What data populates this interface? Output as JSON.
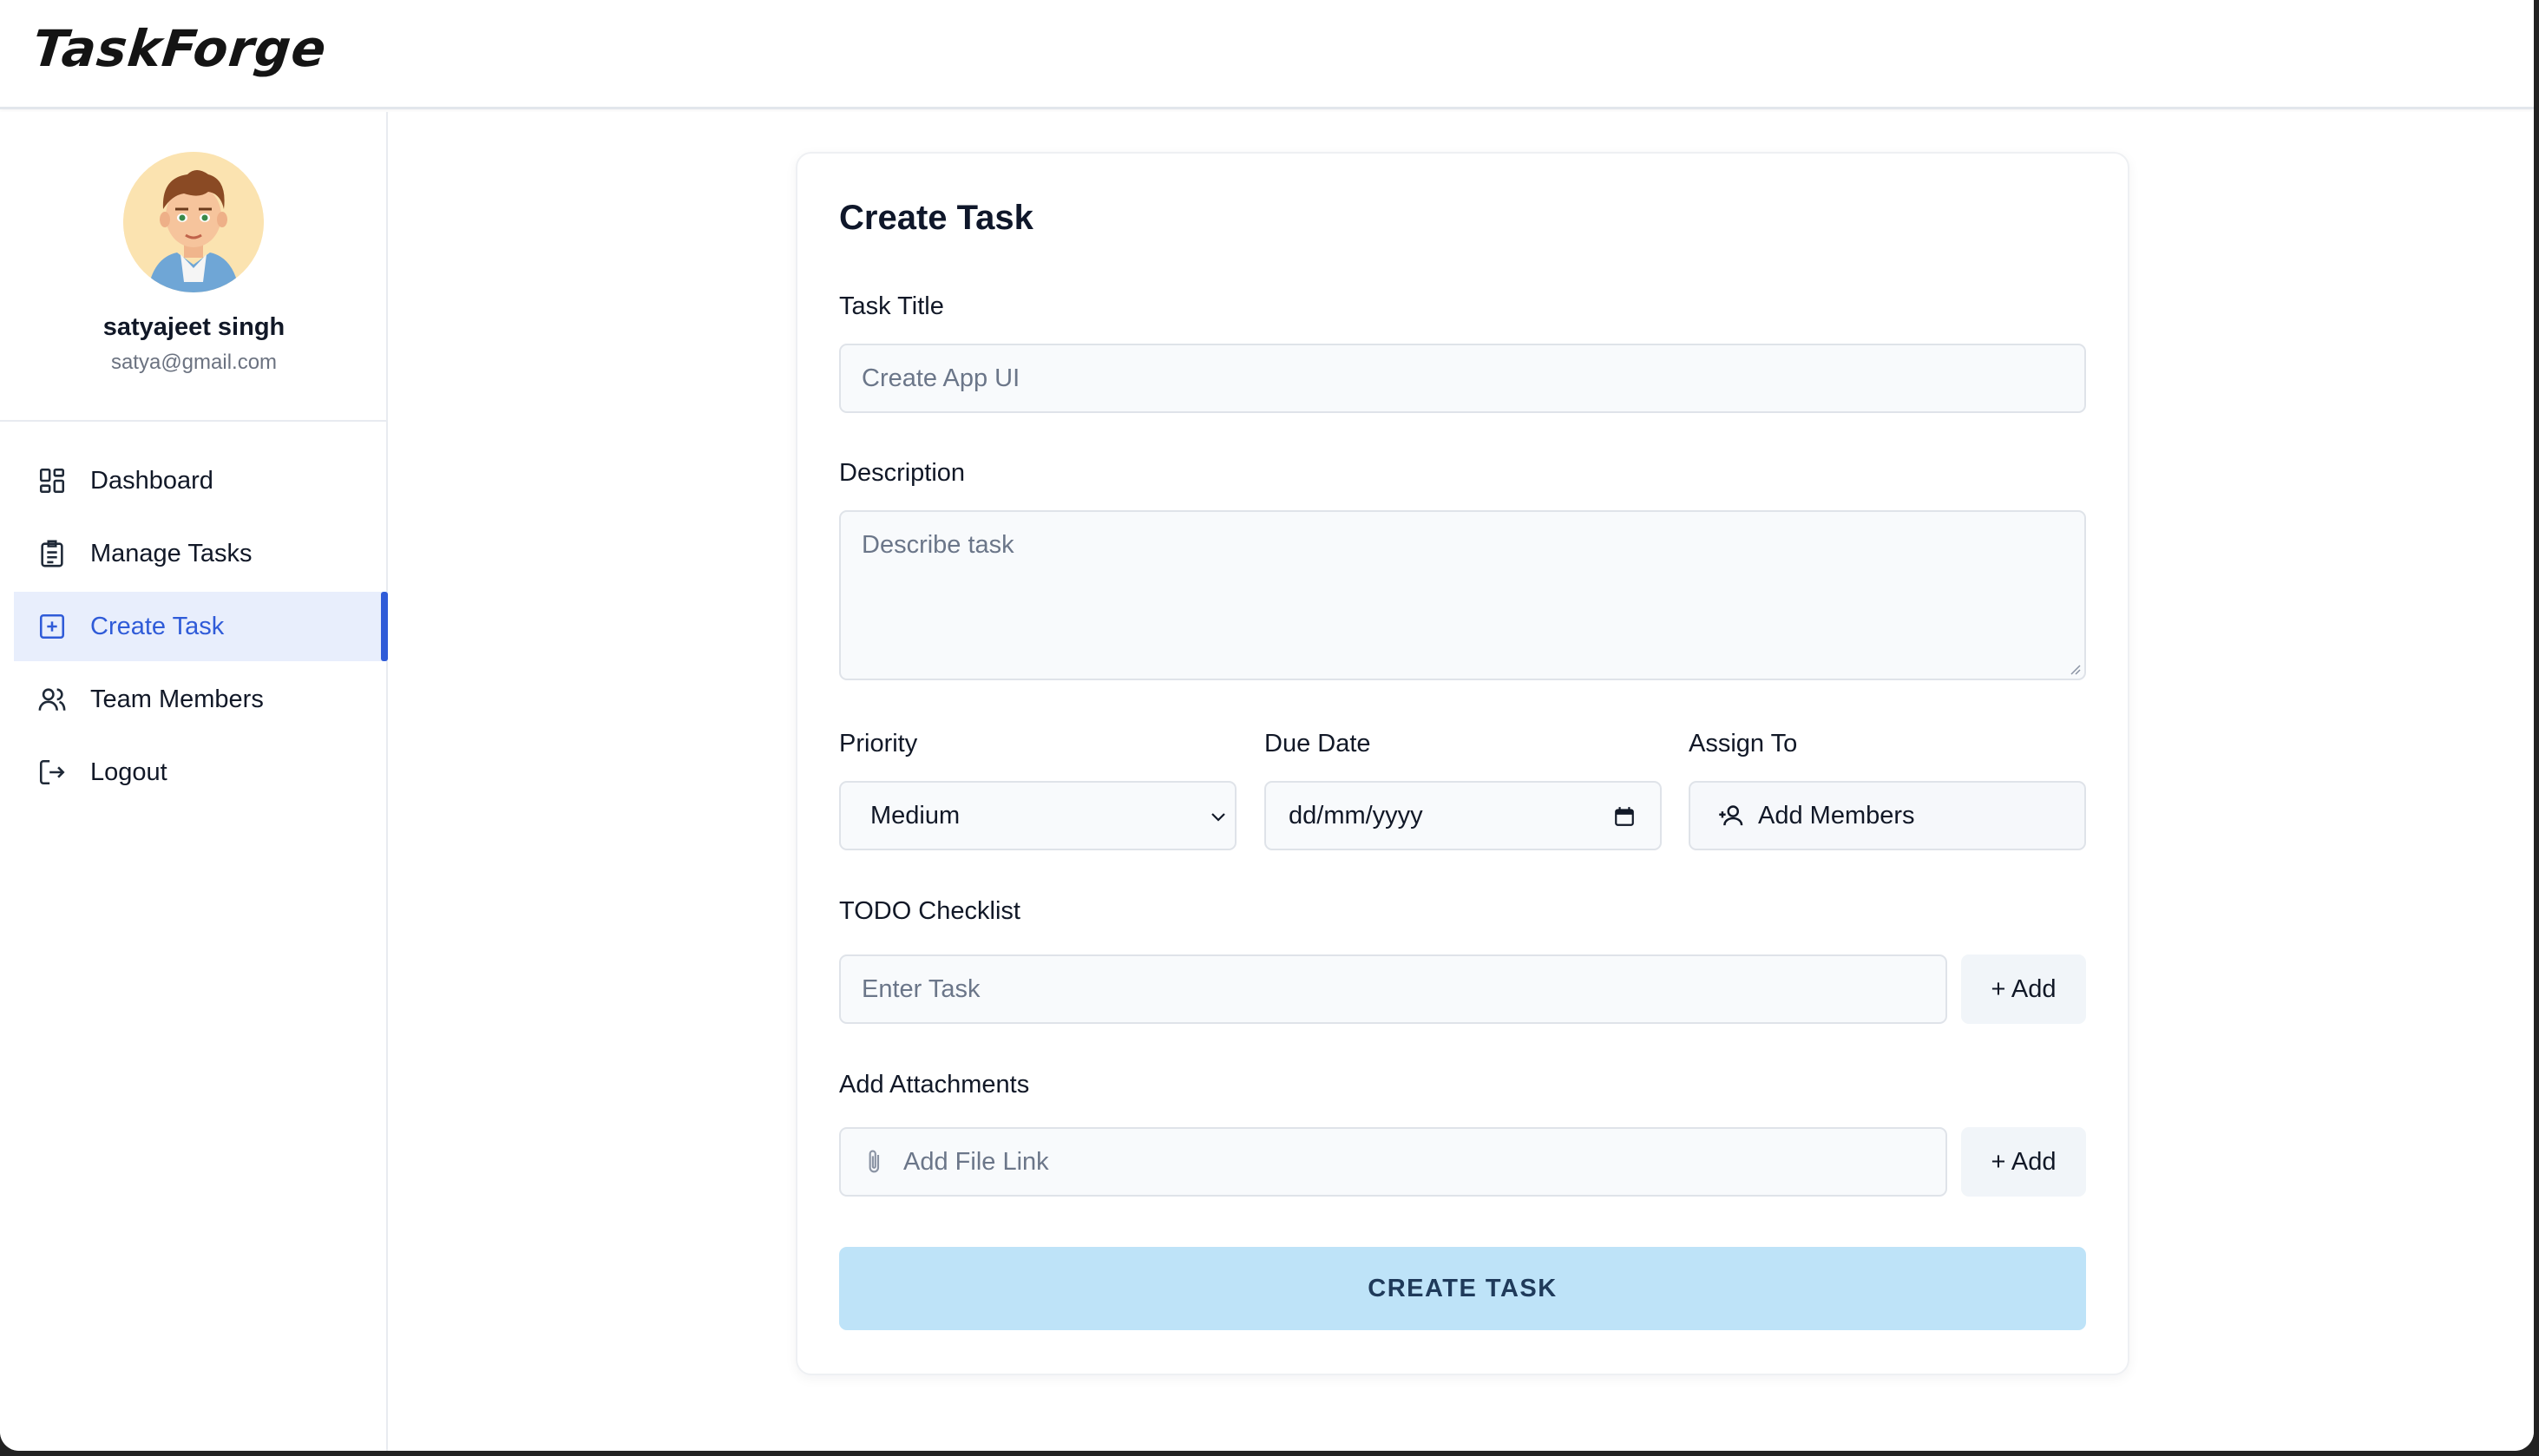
{
  "app": {
    "logo": "TaskForge"
  },
  "user": {
    "name": "satyajeet singh",
    "email": "satya@gmail.com"
  },
  "sidebar": {
    "items": [
      {
        "label": "Dashboard",
        "icon": "dashboard-grid-icon"
      },
      {
        "label": "Manage Tasks",
        "icon": "clipboard-list-icon"
      },
      {
        "label": "Create Task",
        "icon": "square-plus-icon",
        "active": true
      },
      {
        "label": "Team Members",
        "icon": "users-icon"
      },
      {
        "label": "Logout",
        "icon": "logout-icon"
      }
    ],
    "accent_color": "#2f5bd8"
  },
  "form": {
    "title": "Create Task",
    "task_title": {
      "label": "Task Title",
      "placeholder": "Create App UI"
    },
    "description": {
      "label": "Description",
      "placeholder": "Describe task"
    },
    "priority": {
      "label": "Priority",
      "value": "Medium"
    },
    "due_date": {
      "label": "Due Date",
      "placeholder": "dd/mm/yyyy"
    },
    "assign_to": {
      "label": "Assign To",
      "button_label": "Add Members"
    },
    "todo": {
      "label": "TODO Checklist",
      "placeholder": "Enter Task",
      "add_label": "+ Add"
    },
    "attachments": {
      "label": "Add Attachments",
      "placeholder": "Add File Link",
      "add_label": "+ Add"
    },
    "submit_label": "CREATE TASK",
    "submit_color": "#bee3f8"
  }
}
